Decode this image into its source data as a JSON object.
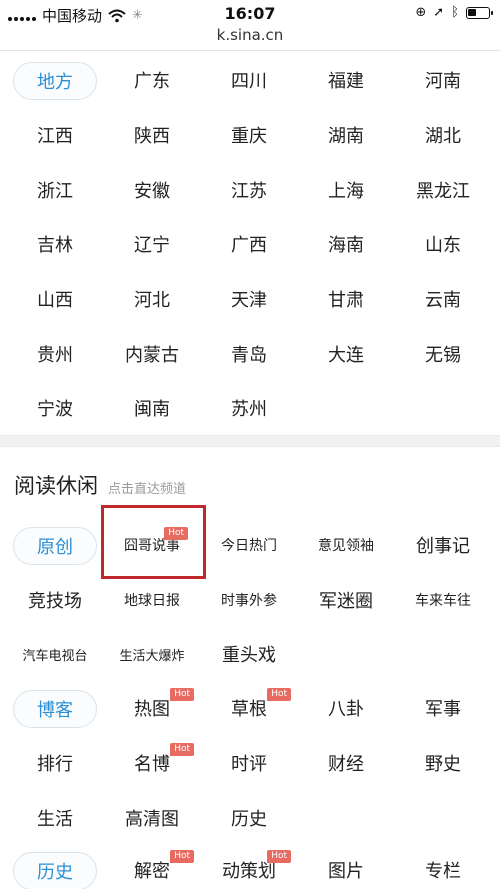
{
  "status_bar": {
    "carrier": "中国移动",
    "time": "16:07",
    "icons": [
      "signal-dots-icon",
      "wifi-icon",
      "loading-spinner-icon",
      "orientation-lock-icon",
      "location-arrow-icon",
      "bluetooth-icon",
      "battery-icon"
    ],
    "battery_level": 0.4
  },
  "browser": {
    "url": "k.sina.cn"
  },
  "regions": {
    "label": "地方",
    "row1": [
      "广东",
      "四川",
      "福建",
      "河南"
    ],
    "rows": [
      [
        "江西",
        "陕西",
        "重庆",
        "湖南",
        "湖北"
      ],
      [
        "浙江",
        "安徽",
        "江苏",
        "上海",
        "黑龙江"
      ],
      [
        "吉林",
        "辽宁",
        "广西",
        "海南",
        "山东"
      ],
      [
        "山西",
        "河北",
        "天津",
        "甘肃",
        "云南"
      ],
      [
        "贵州",
        "内蒙古",
        "青岛",
        "大连",
        "无锡"
      ],
      [
        "宁波",
        "闽南",
        "苏州"
      ]
    ]
  },
  "reading": {
    "title": "阅读休闲",
    "subtitle": "点击直达频道",
    "original_label": "原创",
    "row1": [
      "囧哥说事",
      "今日热门",
      "意见领袖",
      "创事记"
    ],
    "row2": [
      "竞技场",
      "地球日报",
      "时事外参",
      "军迷圈",
      "车来车往"
    ],
    "row3": [
      "汽车电视台",
      "生活大爆炸",
      "重头戏"
    ],
    "blog_label": "博客",
    "row4": [
      "热图",
      "草根",
      "八卦",
      "军事"
    ],
    "row5": [
      "排行",
      "名博",
      "时评",
      "财经",
      "野史"
    ],
    "row6": [
      "生活",
      "高清图",
      "历史"
    ],
    "history_label": "历史",
    "row7": [
      "解密",
      "动策划",
      "图片",
      "专栏"
    ],
    "hot_badge": "Hot"
  },
  "colors": {
    "accent_blue": "#2c8fd6",
    "hot_red": "#e86b62",
    "highlight_red": "#c0282b"
  }
}
